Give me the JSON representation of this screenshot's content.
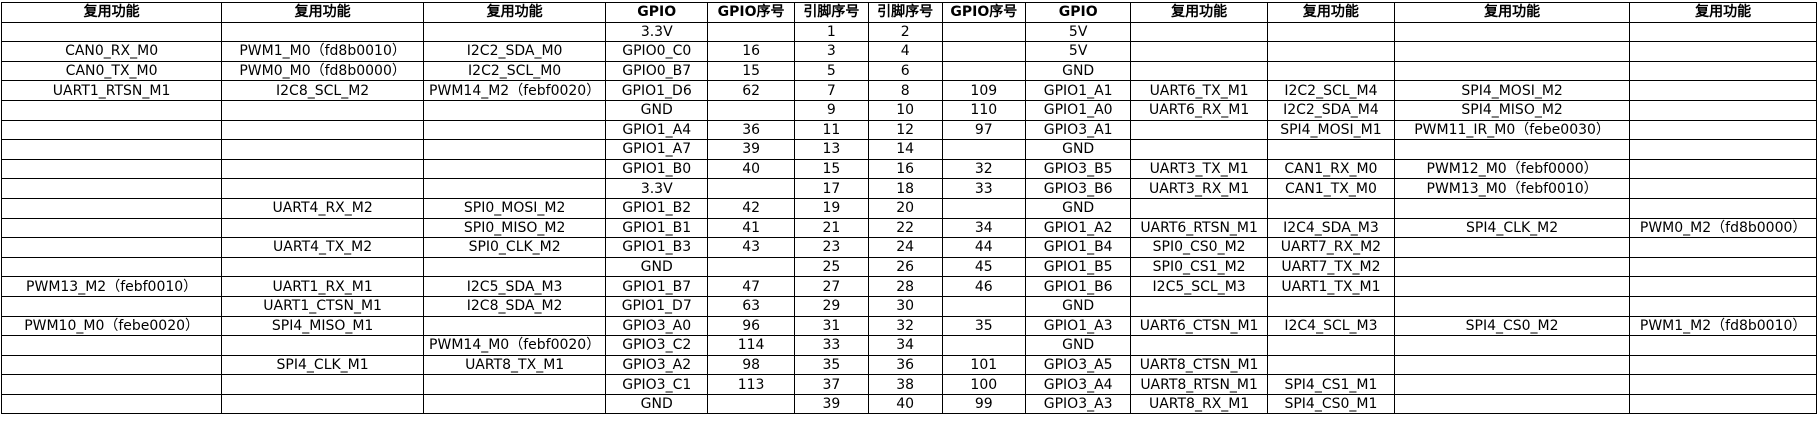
{
  "table": {
    "headers": [
      "复用功能",
      "复用功能",
      "复用功能",
      "GPIO",
      "GPIO序号",
      "引脚序号",
      "引脚序号",
      "GPIO序号",
      "GPIO",
      "复用功能",
      "复用功能",
      "复用功能",
      "复用功能"
    ],
    "rows": [
      [
        "",
        "",
        "",
        "3.3V",
        "",
        "1",
        "2",
        "",
        "5V",
        "",
        "",
        "",
        ""
      ],
      [
        "CAN0_RX_M0",
        "PWM1_M0（fd8b0010）",
        "I2C2_SDA_M0",
        "GPIO0_C0",
        "16",
        "3",
        "4",
        "",
        "5V",
        "",
        "",
        "",
        ""
      ],
      [
        "CAN0_TX_M0",
        "PWM0_M0（fd8b0000）",
        "I2C2_SCL_M0",
        "GPIO0_B7",
        "15",
        "5",
        "6",
        "",
        "GND",
        "",
        "",
        "",
        ""
      ],
      [
        "UART1_RTSN_M1",
        "I2C8_SCL_M2",
        "PWM14_M2（febf0020）",
        "GPIO1_D6",
        "62",
        "7",
        "8",
        "109",
        "GPIO1_A1",
        "UART6_TX_M1",
        "I2C2_SCL_M4",
        "SPI4_MOSI_M2",
        ""
      ],
      [
        "",
        "",
        "",
        "GND",
        "",
        "9",
        "10",
        "110",
        "GPIO1_A0",
        "UART6_RX_M1",
        "I2C2_SDA_M4",
        "SPI4_MISO_M2",
        ""
      ],
      [
        "",
        "",
        "",
        "GPIO1_A4",
        "36",
        "11",
        "12",
        "97",
        "GPIO3_A1",
        "",
        "SPI4_MOSI_M1",
        "PWM11_IR_M0（febe0030）",
        ""
      ],
      [
        "",
        "",
        "",
        "GPIO1_A7",
        "39",
        "13",
        "14",
        "",
        "GND",
        "",
        "",
        "",
        ""
      ],
      [
        "",
        "",
        "",
        "GPIO1_B0",
        "40",
        "15",
        "16",
        "32",
        "GPIO3_B5",
        "UART3_TX_M1",
        "CAN1_RX_M0",
        "PWM12_M0（febf0000）",
        ""
      ],
      [
        "",
        "",
        "",
        "3.3V",
        "",
        "17",
        "18",
        "33",
        "GPIO3_B6",
        "UART3_RX_M1",
        "CAN1_TX_M0",
        "PWM13_M0（febf0010）",
        ""
      ],
      [
        "",
        "UART4_RX_M2",
        "SPI0_MOSI_M2",
        "GPIO1_B2",
        "42",
        "19",
        "20",
        "",
        "GND",
        "",
        "",
        "",
        ""
      ],
      [
        "",
        "",
        "SPI0_MISO_M2",
        "GPIO1_B1",
        "41",
        "21",
        "22",
        "34",
        "GPIO1_A2",
        "UART6_RTSN_M1",
        "I2C4_SDA_M3",
        "SPI4_CLK_M2",
        "PWM0_M2（fd8b0000）"
      ],
      [
        "",
        "UART4_TX_M2",
        "SPI0_CLK_M2",
        "GPIO1_B3",
        "43",
        "23",
        "24",
        "44",
        "GPIO1_B4",
        "SPI0_CS0_M2",
        "UART7_RX_M2",
        "",
        ""
      ],
      [
        "",
        "",
        "",
        "GND",
        "",
        "25",
        "26",
        "45",
        "GPIO1_B5",
        "SPI0_CS1_M2",
        "UART7_TX_M2",
        "",
        ""
      ],
      [
        "PWM13_M2（febf0010）",
        "UART1_RX_M1",
        "I2C5_SDA_M3",
        "GPIO1_B7",
        "47",
        "27",
        "28",
        "46",
        "GPIO1_B6",
        "I2C5_SCL_M3",
        "UART1_TX_M1",
        "",
        ""
      ],
      [
        "",
        "UART1_CTSN_M1",
        "I2C8_SDA_M2",
        "GPIO1_D7",
        "63",
        "29",
        "30",
        "",
        "GND",
        "",
        "",
        "",
        ""
      ],
      [
        "PWM10_M0（febe0020）",
        "SPI4_MISO_M1",
        "",
        "GPIO3_A0",
        "96",
        "31",
        "32",
        "35",
        "GPIO1_A3",
        "UART6_CTSN_M1",
        "I2C4_SCL_M3",
        "SPI4_CS0_M2",
        "PWM1_M2（fd8b0010）"
      ],
      [
        "",
        "",
        "PWM14_M0（febf0020）",
        "GPIO3_C2",
        "114",
        "33",
        "34",
        "",
        "GND",
        "",
        "",
        "",
        ""
      ],
      [
        "",
        "SPI4_CLK_M1",
        "UART8_TX_M1",
        "GPIO3_A2",
        "98",
        "35",
        "36",
        "101",
        "GPIO3_A5",
        "UART8_CTSN_M1",
        "",
        "",
        ""
      ],
      [
        "",
        "",
        "",
        "GPIO3_C1",
        "113",
        "37",
        "38",
        "100",
        "GPIO3_A4",
        "UART8_RTSN_M1",
        "SPI4_CS1_M1",
        "",
        ""
      ],
      [
        "",
        "",
        "",
        "GND",
        "",
        "39",
        "40",
        "99",
        "GPIO3_A3",
        "UART8_RX_M1",
        "SPI4_CS0_M1",
        "",
        ""
      ]
    ]
  }
}
